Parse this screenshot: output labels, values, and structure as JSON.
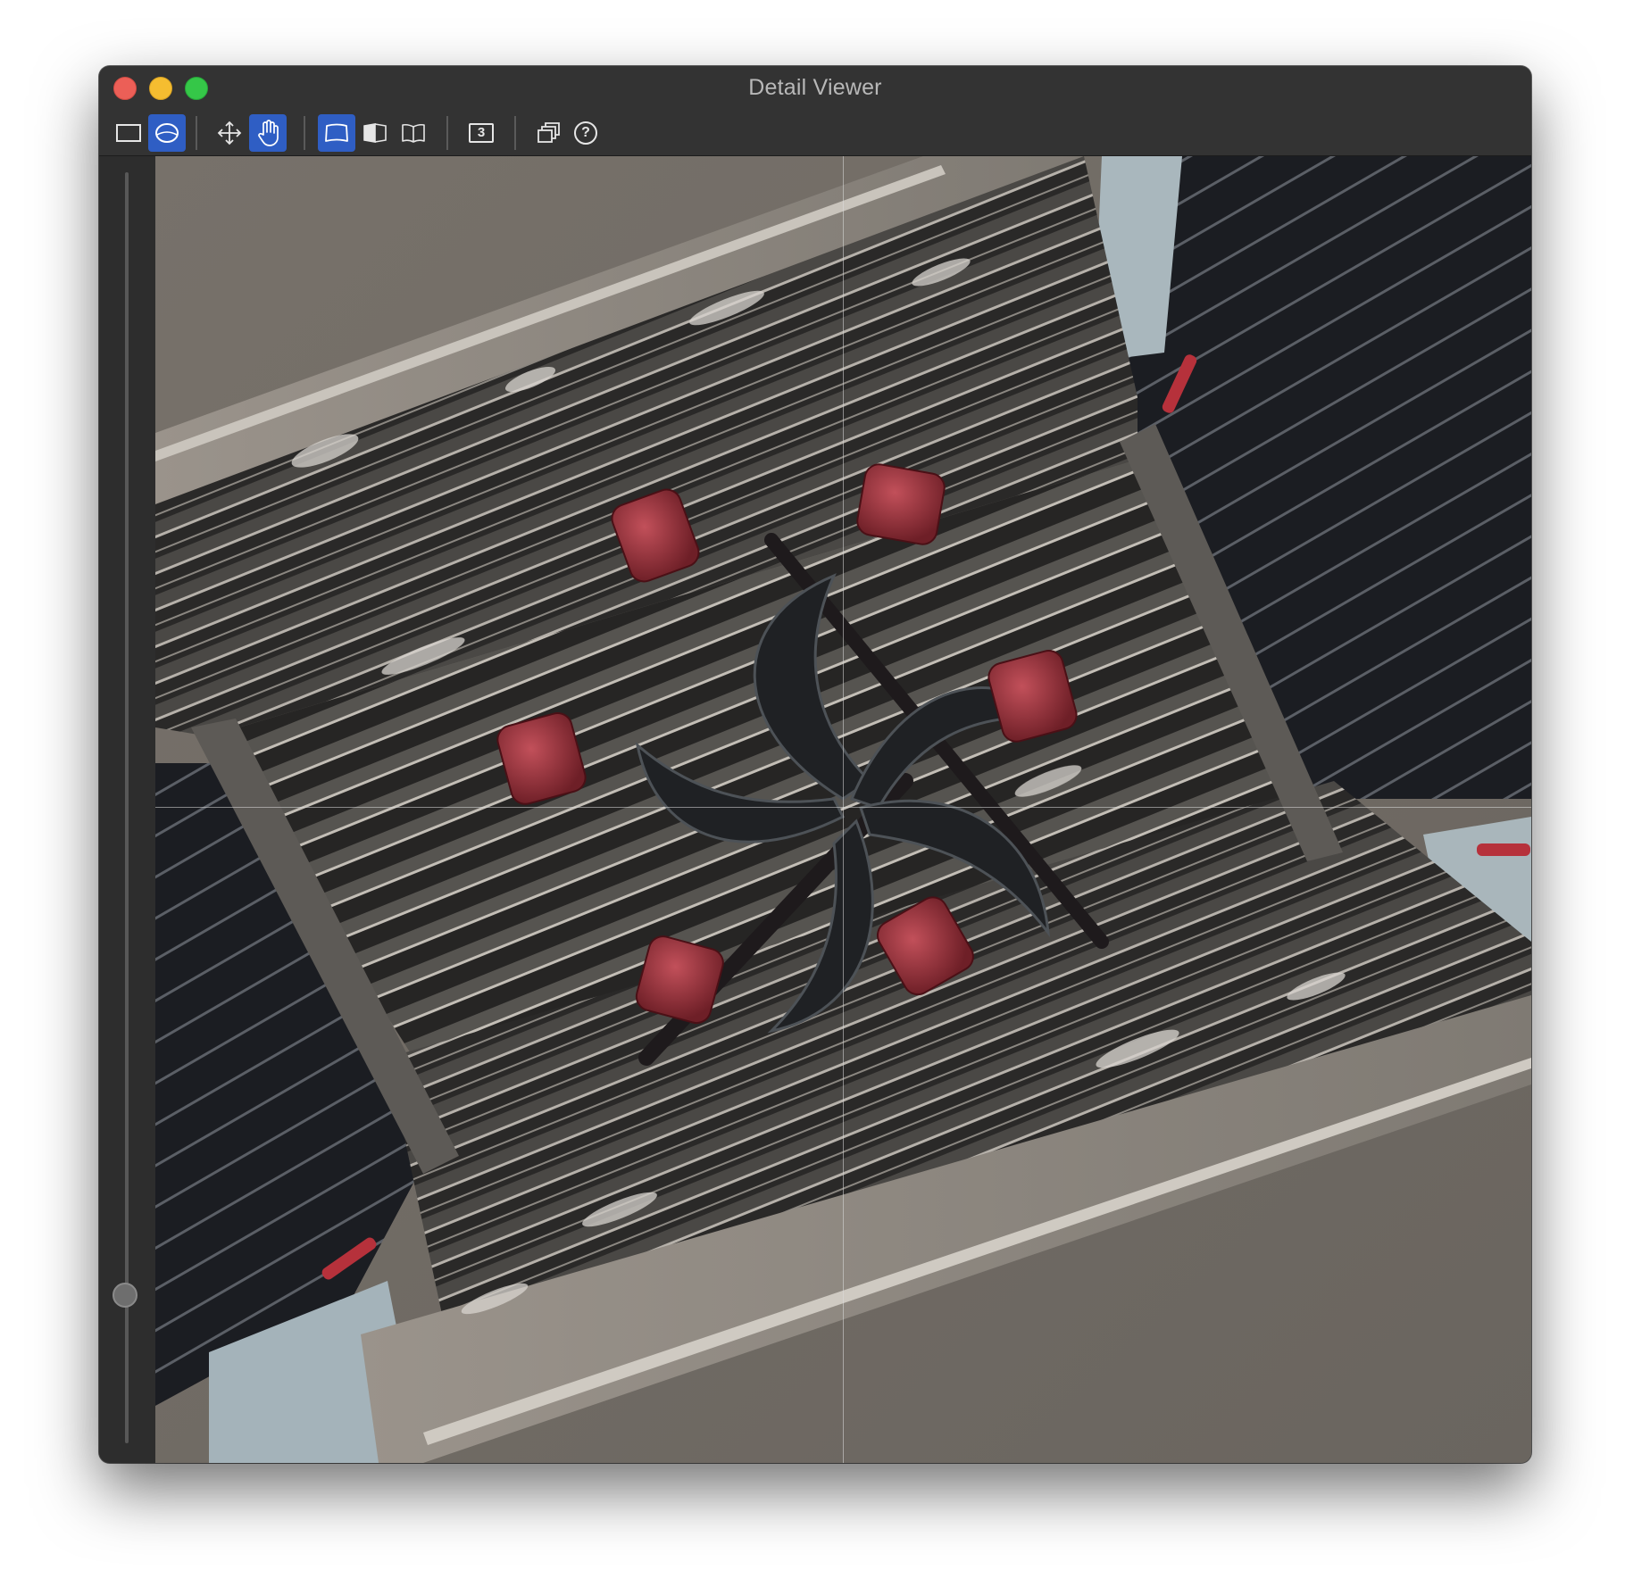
{
  "window": {
    "title": "Detail Viewer"
  },
  "toolbar": {
    "buttons": [
      {
        "icon": "rectangle-select-icon",
        "active": false
      },
      {
        "icon": "ellipse-select-icon",
        "active": true
      },
      {
        "icon": "move-arrows-icon",
        "active": false
      },
      {
        "icon": "hand-pan-icon",
        "active": true
      },
      {
        "icon": "perspective-single-icon",
        "active": true
      },
      {
        "icon": "perspective-split-icon",
        "active": false
      },
      {
        "icon": "perspective-book-icon",
        "active": false
      },
      {
        "icon": "number-three-icon",
        "active": false,
        "label": "3"
      },
      {
        "icon": "layers-stack-icon",
        "active": false
      },
      {
        "icon": "help-icon",
        "active": false,
        "label": "?"
      }
    ]
  },
  "slider": {
    "zoom_fraction": 0.88
  },
  "colors": {
    "accent": "#2f5ec4",
    "titlebar": "#333333",
    "title_text": "#b8b8b8"
  }
}
